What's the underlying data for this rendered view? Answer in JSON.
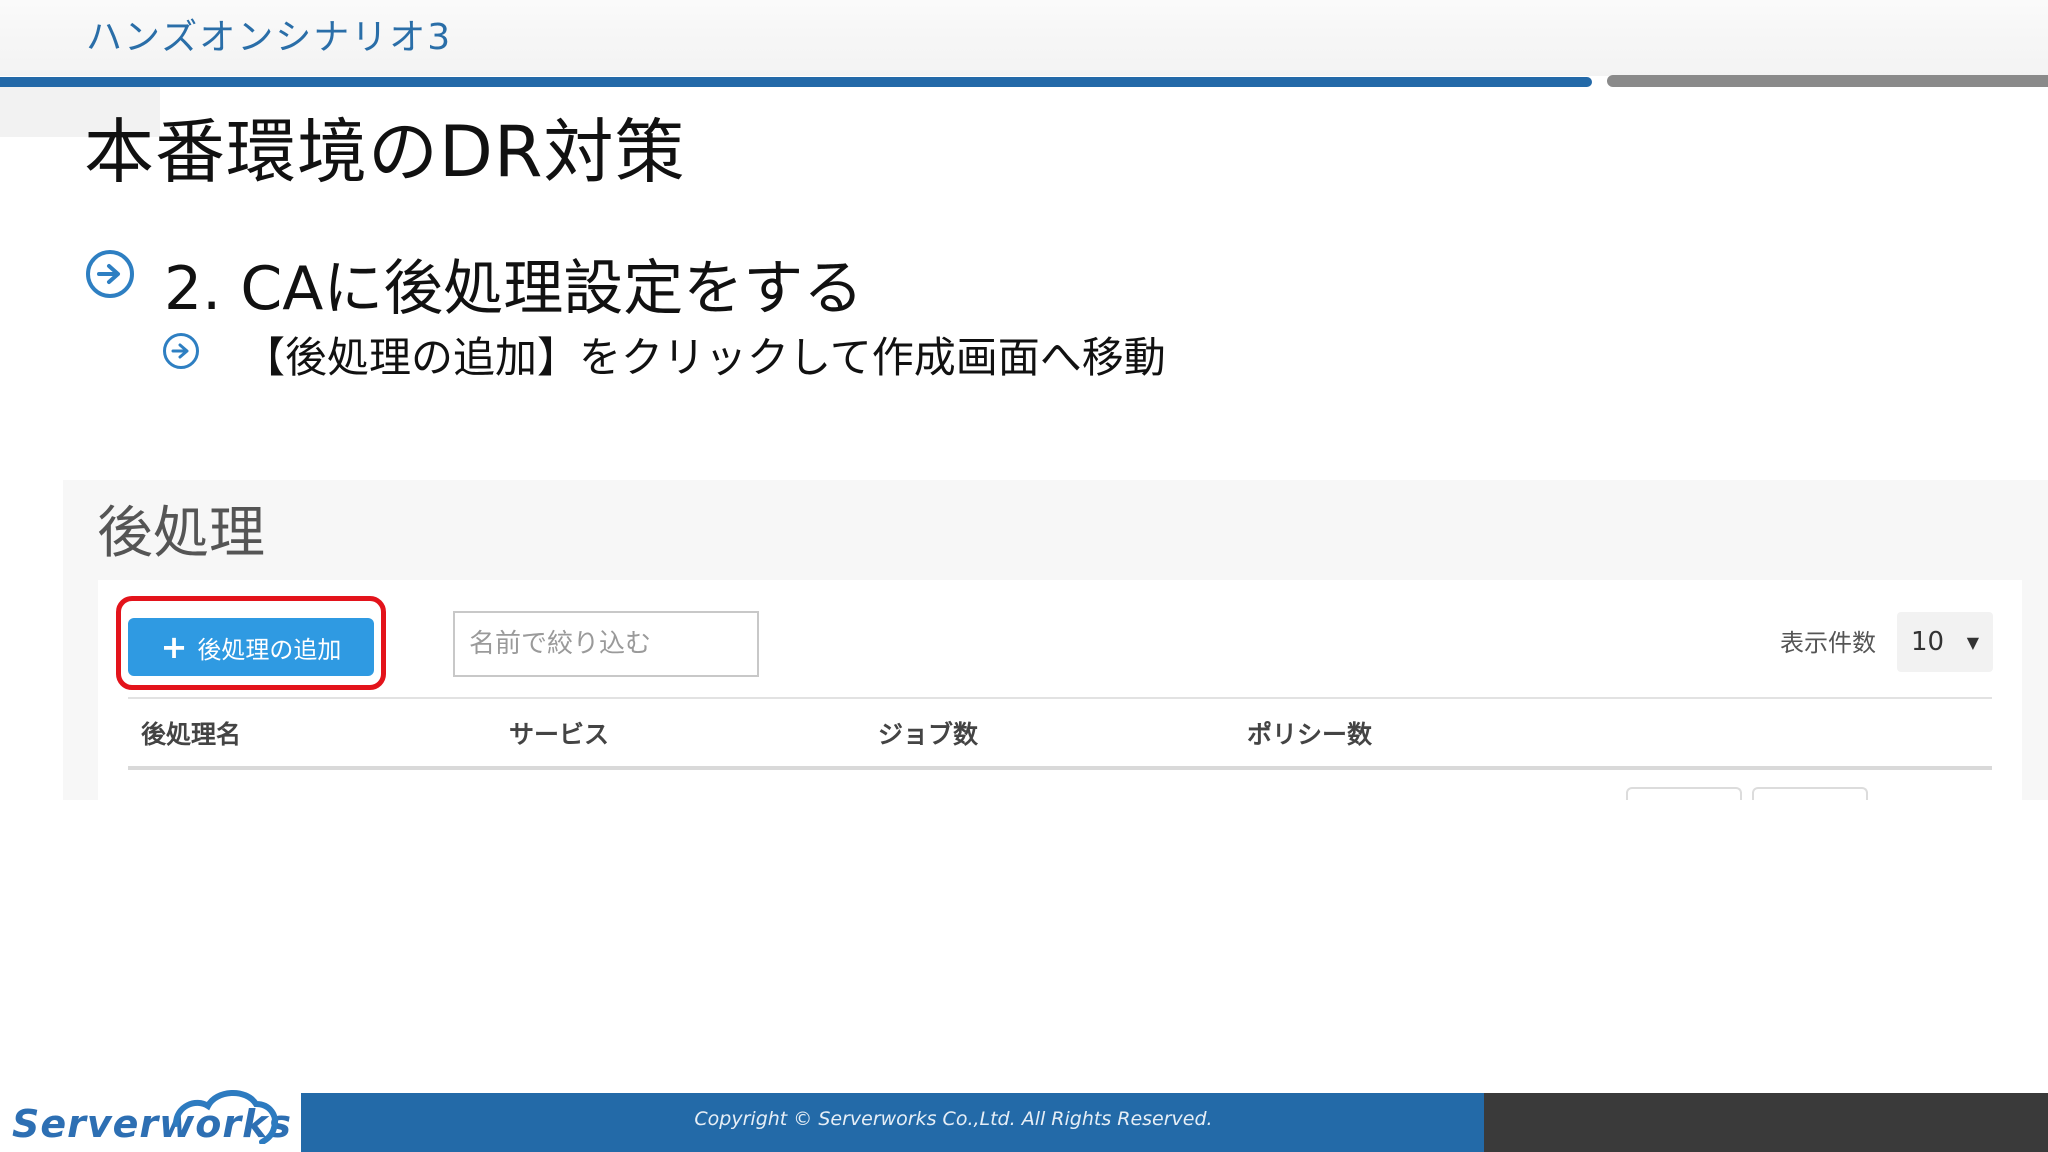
{
  "header": {
    "series_title": "ハンズオンシナリオ3",
    "slide_title": "本番環境のDR対策"
  },
  "bullets": [
    {
      "icon": "arrow-circle-icon",
      "text": "2.  CAに後処理設定をする"
    },
    {
      "icon": "arrow-circle-icon",
      "text": "【後処理の追加】をクリックして作成画面へ移動"
    }
  ],
  "screenshot": {
    "heading": "後処理",
    "add_button_label": "後処理の追加",
    "filter_placeholder": "名前で絞り込む",
    "per_page_label": "表示件数",
    "per_page_value": "10",
    "columns": [
      "後処理名",
      "サービス",
      "ジョブ数",
      "ポリシー数"
    ],
    "highlight_color": "#e3131b",
    "button_color": "#2f9ae2"
  },
  "footer": {
    "copyright": "Copyright ©  Serverworks Co.,Ltd. All Rights Reserved.",
    "logo": "Serverworks"
  }
}
